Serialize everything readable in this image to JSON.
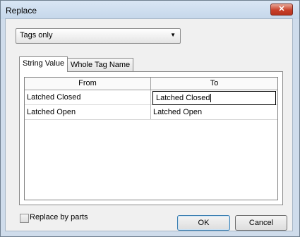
{
  "window": {
    "title": "Replace",
    "close_glyph": "✕"
  },
  "scope_select": {
    "value": "Tags only",
    "arrow": "▼"
  },
  "tabs": [
    {
      "label": "String Value",
      "active": true
    },
    {
      "label": "Whole Tag Name",
      "active": false
    }
  ],
  "grid": {
    "columns": [
      "From",
      "To"
    ],
    "rows": [
      {
        "from": "Latched Closed",
        "to": "Latched Closed"
      },
      {
        "from": "Latched Open",
        "to": "Latched Open"
      }
    ]
  },
  "options": {
    "replace_by_parts_label": "Replace by parts",
    "replace_by_parts_checked": false
  },
  "buttons": {
    "ok": "OK",
    "cancel": "Cancel"
  }
}
